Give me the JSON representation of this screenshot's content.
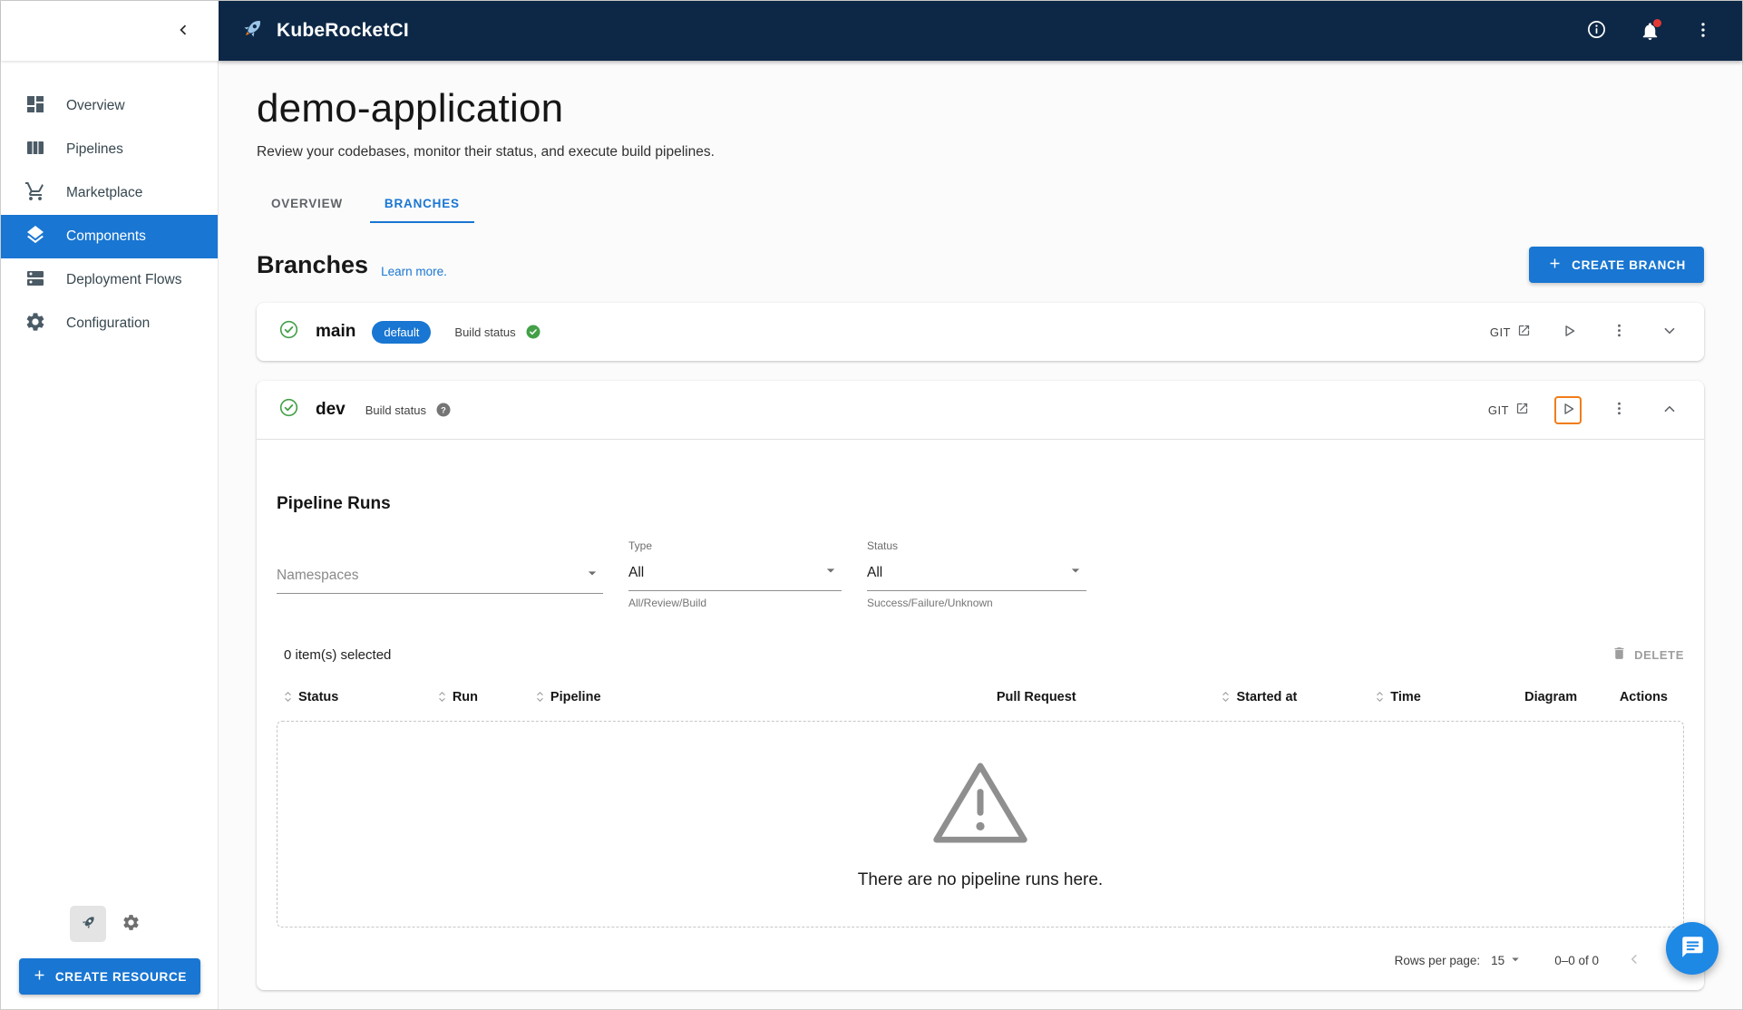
{
  "colors": {
    "appbar_bg": "#0d2846",
    "accent_blue": "#1976d2",
    "success_green": "#43a047",
    "focus_orange": "#ef7d1a",
    "fab_blue": "#1e88e5"
  },
  "icons": [
    "rocket-logo-icon",
    "info-icon",
    "notifications-bell-icon",
    "kebab-menu-icon",
    "collapse-sidebar-icon",
    "dashboard-icon",
    "pipelines-icon",
    "cart-icon",
    "layers-icon",
    "stack-icon",
    "gear-icon",
    "plus-icon",
    "check-circle-icon",
    "success-badge-icon",
    "help-badge-icon",
    "external-link-icon",
    "play-icon",
    "chevron-down-icon",
    "chevron-up-icon",
    "dropdown-caret-icon",
    "sort-icon",
    "trash-icon",
    "warning-triangle-icon",
    "chevron-left-icon",
    "chevron-right-icon",
    "chat-icon"
  ],
  "app_bar": {
    "title": "KubeRocketCI"
  },
  "sidebar": {
    "items": [
      {
        "label": "Overview"
      },
      {
        "label": "Pipelines"
      },
      {
        "label": "Marketplace"
      },
      {
        "label": "Components",
        "active": true
      },
      {
        "label": "Deployment Flows"
      },
      {
        "label": "Configuration"
      }
    ],
    "create_resource_label": "CREATE RESOURCE"
  },
  "page": {
    "title": "demo-application",
    "subtitle": "Review your codebases, monitor their status, and execute build pipelines.",
    "tabs": [
      {
        "label": "OVERVIEW"
      },
      {
        "label": "BRANCHES"
      }
    ],
    "section_title": "Branches",
    "learn_more": "Learn more.",
    "create_branch_label": "CREATE BRANCH"
  },
  "branches": [
    {
      "name": "main",
      "default_chip": "default",
      "build_status_label": "Build status",
      "build_status": "success",
      "git_label": "GIT"
    },
    {
      "name": "dev",
      "build_status_label": "Build status",
      "build_status": "unknown",
      "git_label": "GIT"
    }
  ],
  "pipeline_runs": {
    "title": "Pipeline Runs",
    "filters": {
      "namespaces": {
        "placeholder": "Namespaces"
      },
      "type": {
        "label": "Type",
        "value": "All",
        "helper": "All/Review/Build"
      },
      "status": {
        "label": "Status",
        "value": "All",
        "helper": "Success/Failure/Unknown"
      }
    },
    "selected_text": "0 item(s) selected",
    "delete_label": "DELETE",
    "table": {
      "columns": [
        "Status",
        "Run",
        "Pipeline",
        "Pull Request",
        "Started at",
        "Time",
        "Diagram",
        "Actions"
      ]
    },
    "empty_text": "There are no pipeline runs here.",
    "pagination": {
      "rows_per_page_label": "Rows per page:",
      "rows_per_page_value": "15",
      "range_text": "0–0 of 0"
    }
  }
}
